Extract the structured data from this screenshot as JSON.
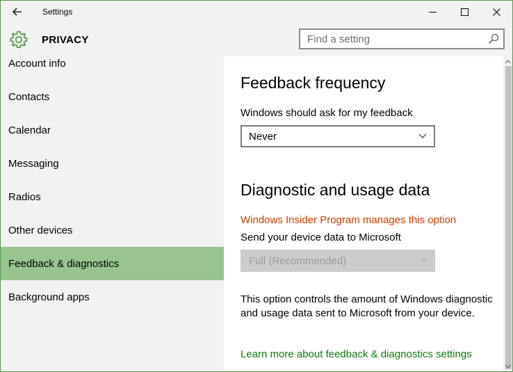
{
  "window": {
    "title": "Settings",
    "accent_color": "#5a9a4e"
  },
  "header": {
    "section_title": "PRIVACY",
    "search": {
      "placeholder": "Find a setting",
      "value": ""
    }
  },
  "sidebar": {
    "selected_color": "#98c490",
    "items": [
      {
        "label": "Account info"
      },
      {
        "label": "Contacts"
      },
      {
        "label": "Calendar"
      },
      {
        "label": "Messaging"
      },
      {
        "label": "Radios"
      },
      {
        "label": "Other devices"
      },
      {
        "label": "Feedback & diagnostics",
        "selected": true
      },
      {
        "label": "Background apps"
      }
    ]
  },
  "content": {
    "feedback": {
      "heading": "Feedback frequency",
      "label": "Windows should ask for my feedback",
      "selected_value": "Never"
    },
    "diagnostic": {
      "heading": "Diagnostic and usage data",
      "warning": "Windows Insider Program manages this option",
      "warning_color": "#d83b01",
      "label": "Send your device data to Microsoft",
      "selected_value": "Full (Recommended)",
      "disabled": true,
      "description": "This option controls the amount of Windows diagnostic and usage data sent to Microsoft from your device."
    },
    "link": {
      "text": "Learn more about feedback & diagnostics settings",
      "color": "#107c10"
    }
  },
  "icons": {
    "back": "back-arrow-icon",
    "minimize": "minimize-icon",
    "maximize": "maximize-icon",
    "close": "close-icon",
    "gear": "gear-icon",
    "search": "search-icon",
    "dropdown": "chevron-down-icon"
  }
}
